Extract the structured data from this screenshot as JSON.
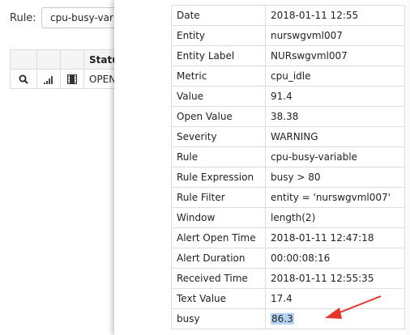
{
  "background": {
    "rule_label": "Rule:",
    "rule_select_value": "cpu-busy-varia",
    "table": {
      "status_header": "Statu",
      "row_status": "OPEN"
    },
    "icons": [
      "search-icon",
      "signal-bars-icon",
      "film-icon"
    ]
  },
  "details": [
    {
      "key": "Date",
      "value": "2018-01-11 12:55"
    },
    {
      "key": "Entity",
      "value": "nurswgvml007"
    },
    {
      "key": "Entity Label",
      "value": "NURswgvml007"
    },
    {
      "key": "Metric",
      "value": "cpu_idle"
    },
    {
      "key": "Value",
      "value": "91.4"
    },
    {
      "key": "Open Value",
      "value": "38.38"
    },
    {
      "key": "Severity",
      "value": "WARNING"
    },
    {
      "key": "Rule",
      "value": "cpu-busy-variable"
    },
    {
      "key": "Rule Expression",
      "value": "busy > 80"
    },
    {
      "key": "Rule Filter",
      "value": "entity = 'nurswgvml007'"
    },
    {
      "key": "Window",
      "value": "length(2)"
    },
    {
      "key": "Alert Open Time",
      "value": "2018-01-11 12:47:18"
    },
    {
      "key": "Alert Duration",
      "value": "00:00:08:16"
    },
    {
      "key": "Received Time",
      "value": "2018-01-11 12:55:35"
    },
    {
      "key": "Text Value",
      "value": "17.4"
    },
    {
      "key": "busy",
      "value": "86.3"
    }
  ],
  "colors": {
    "selection_highlight": "#b5d4f5",
    "annotation_arrow": "#e8352b"
  }
}
